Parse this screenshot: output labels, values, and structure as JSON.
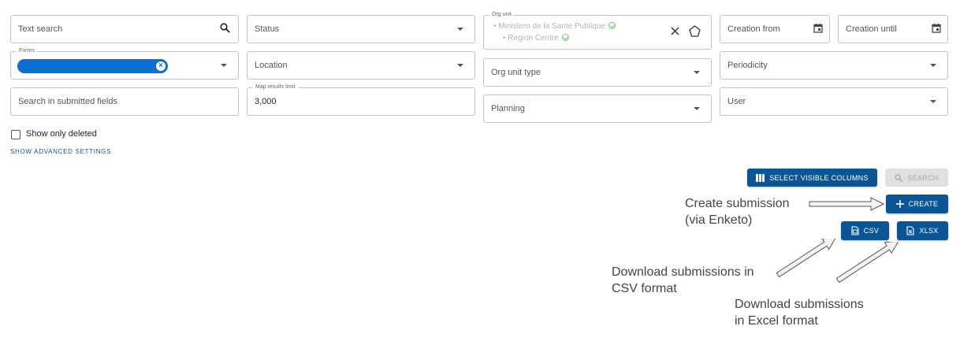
{
  "filters": {
    "text_search": "Text search",
    "status": "Status",
    "org_unit": {
      "legend": "Org unit",
      "items": [
        "Ministero de la Sante Publique",
        "Region Centre"
      ]
    },
    "creation_from": "Creation from",
    "creation_until": "Creation until",
    "forms": {
      "legend": "Forms"
    },
    "location": "Location",
    "periodicity": "Periodicity",
    "org_unit_type": "Org unit type",
    "search_submitted_fields": "Search in submitted fields",
    "map_results_limit": {
      "legend": "Map results limit",
      "value": "3,000"
    },
    "planning": "Planning",
    "user": "User",
    "show_only_deleted": "Show only deleted",
    "show_advanced_settings": "SHOW ADVANCED SETTINGS"
  },
  "actions": {
    "select_visible_columns": "SELECT VISIBLE COLUMNS",
    "search": "SEARCH",
    "create": "CREATE",
    "csv": "CSV",
    "xlsx": "XLSX"
  },
  "annotations": {
    "create_line1": "Create submission",
    "create_line2": "(via Enketo)",
    "csv_line1": "Download submissions in",
    "csv_line2": "CSV format",
    "xlsx_line1": "Download submissions",
    "xlsx_line2": "in Excel format"
  },
  "colors": {
    "primary": "#0b5594",
    "chip": "#0f6fd1",
    "check": "#78c178",
    "disabled": "#e0e0e0"
  },
  "icons": [
    "search-icon",
    "chevron-down-icon",
    "close-icon",
    "pentagon-icon",
    "calendar-icon",
    "check-circle-icon",
    "columns-icon",
    "plus-icon",
    "csv-file-icon",
    "xlsx-file-icon",
    "arrow-icon"
  ]
}
